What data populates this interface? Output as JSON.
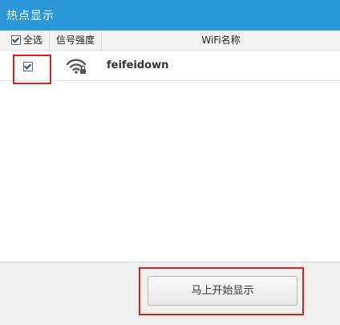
{
  "window": {
    "title": "热点显示"
  },
  "table": {
    "headers": {
      "select_all": "全选",
      "signal": "信号强度",
      "name": "WiFi名称"
    },
    "select_all_checked": true,
    "rows": [
      {
        "checked": true,
        "signal_icon": "wifi-signal-lock-icon",
        "ssid": "feifeidown"
      }
    ]
  },
  "footer": {
    "start_button_label": "马上开始显示"
  },
  "colors": {
    "titlebar": "#2a97d8",
    "highlight": "#e02020"
  }
}
